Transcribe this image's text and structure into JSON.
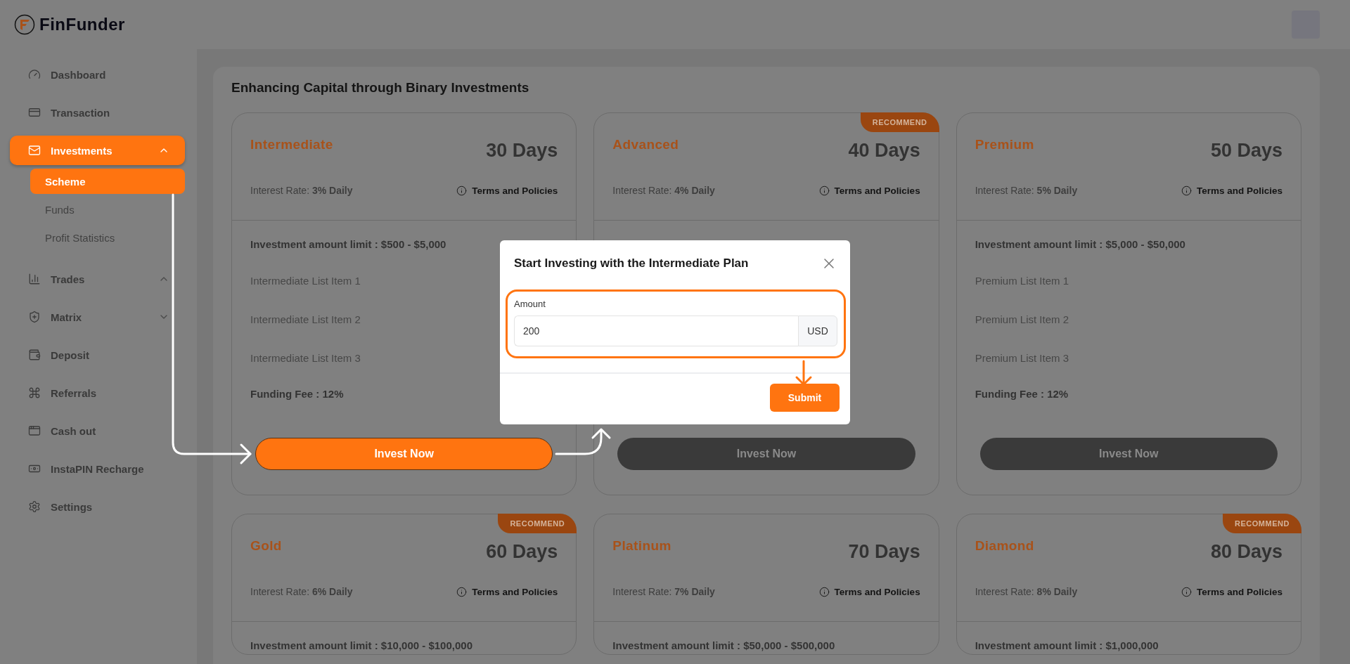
{
  "app": {
    "logo": "FinFunder"
  },
  "sidebar": {
    "items": [
      {
        "label": "Dashboard",
        "selected": false
      },
      {
        "label": "Transaction",
        "selected": false
      },
      {
        "label": "Investments",
        "selected": true,
        "expanded": true,
        "children": [
          {
            "label": "Scheme",
            "selected": true
          },
          {
            "label": "Funds",
            "selected": false
          },
          {
            "label": "Profit Statistics",
            "selected": false
          }
        ]
      },
      {
        "label": "Trades",
        "selected": false,
        "expanded": true
      },
      {
        "label": "Matrix",
        "selected": false,
        "expanded": false
      },
      {
        "label": "Deposit",
        "selected": false
      },
      {
        "label": "Referrals",
        "selected": false
      },
      {
        "label": "Cash out",
        "selected": false
      },
      {
        "label": "InstaPIN Recharge",
        "selected": false
      },
      {
        "label": "Settings",
        "selected": false
      }
    ]
  },
  "section": {
    "title": "Enhancing Capital through Binary Investments",
    "plans": [
      {
        "name": "Intermediate",
        "duration": "30 Days",
        "interest": "Interest Rate: **3% Daily**",
        "terms": "Terms and Policies",
        "limit": "Investment amount limit : **$500 - $5,000**",
        "items": [
          "Intermediate List Item 1",
          "Intermediate List Item 2",
          "Intermediate List Item 3"
        ],
        "fee": "Funding Fee : **12%**",
        "button": "Invest Now",
        "highlighted": true
      },
      {
        "name": "Advanced",
        "badge": "RECOMMEND",
        "duration": "40 Days",
        "interest": "Interest Rate: **4% Daily**",
        "terms": "Terms and Policies",
        "button": "Invest Now",
        "highlighted": false
      },
      {
        "name": "Premium",
        "duration": "50 Days",
        "interest": "Interest Rate: **5% Daily**",
        "terms": "Terms and Policies",
        "limit": "Investment amount limit : **$5,000 - $50,000**",
        "items": [
          "Premium List Item 1",
          "Premium List Item 2",
          "Premium List Item 3"
        ],
        "fee": "Funding Fee : **12%**",
        "button": "Invest Now",
        "highlighted": false
      },
      {
        "name": "Gold",
        "badge": "RECOMMEND",
        "duration": "60 Days",
        "interest": "Interest Rate: **6% Daily**",
        "terms": "Terms and Policies",
        "limit": "Investment amount limit : **$10,000 - $100,000**"
      },
      {
        "name": "Platinum",
        "duration": "70 Days",
        "interest": "Interest Rate: **7% Daily**",
        "terms": "Terms and Policies",
        "limit": "Investment amount limit : **$50,000 - $500,000**"
      },
      {
        "name": "Diamond",
        "badge": "RECOMMEND",
        "duration": "80 Days",
        "interest": "Interest Rate: **8% Daily**",
        "terms": "Terms and Policies",
        "limit": "Investment amount limit : **$1,000,000**"
      }
    ]
  },
  "modal": {
    "title": "Start Investing with the Intermediate Plan",
    "field": {
      "label": "Amount",
      "value": "200",
      "suffix": "USD"
    },
    "submit": "Submit"
  }
}
